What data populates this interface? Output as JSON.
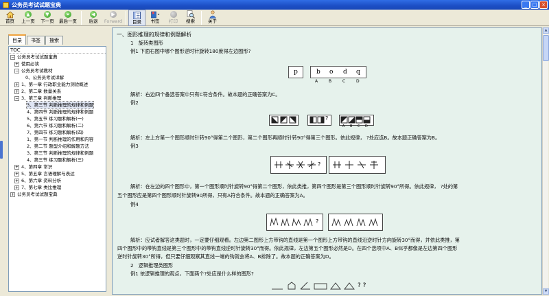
{
  "window": {
    "title": "公务员考试试题宝典",
    "buttons": {
      "minimize": "_",
      "maximize": "□",
      "close": "×"
    }
  },
  "toolbar": {
    "home": "首页",
    "prev_page": "上一页",
    "next_page": "下一页",
    "last_page": "最后一页",
    "back": "后退",
    "forward": "Forward",
    "contents": "目录",
    "bookmark": "书签",
    "print": "打印",
    "search": "搜索",
    "about": "关于"
  },
  "left_pane": {
    "tabs": [
      "目录",
      "书签",
      "搜索"
    ],
    "tree_header": "TOC",
    "tree": [
      {
        "label": "公务员考试试题宝典",
        "expander": "⊟"
      },
      {
        "label": "使用必读",
        "expander": "⊞"
      },
      {
        "label": "公务员考试教材",
        "expander": "⊟"
      },
      {
        "label": "0、公务员考试详解",
        "expander": ""
      },
      {
        "label": "1、第一章 行政职业能力测验概述",
        "expander": "⊞"
      },
      {
        "label": "2、第二章 数量关系",
        "expander": "⊞"
      },
      {
        "label": "3、第三章 判断推理",
        "expander": "⊟"
      },
      {
        "label": "3、第三节 判断推理的规律和例题",
        "expander": "",
        "selected": true
      },
      {
        "label": "4、第四节 判断推理的规律和例题",
        "expander": ""
      },
      {
        "label": "5、第五节 练习题和解析(一)",
        "expander": ""
      },
      {
        "label": "6、第六节 练习题和解析(二)",
        "expander": ""
      },
      {
        "label": "7、第四节 练习题和解析(四)",
        "expander": ""
      },
      {
        "label": "1、第一节 判断推理的作用和内容",
        "expander": ""
      },
      {
        "label": "2、第二节 题型介绍和解题方法",
        "expander": ""
      },
      {
        "label": "3、第三节 判断推理的规律和例题",
        "expander": ""
      },
      {
        "label": "4、第三节 练习题和解析(三)",
        "expander": ""
      },
      {
        "label": "4、第四章 常识",
        "expander": "⊞"
      },
      {
        "label": "5、第五章 言语理解与表达",
        "expander": "⊞"
      },
      {
        "label": "6、第六章 资料分析",
        "expander": "⊞"
      },
      {
        "label": "7、第七章 类比推理",
        "expander": "⊞"
      },
      {
        "label": "公务员考试试题宝典",
        "expander": "⊞"
      }
    ]
  },
  "content": {
    "heading": "一、图形推理的规律和例题解析",
    "section1": "1　旋转类图形",
    "ex1_question": "例1 下面右图中哪个图形逆时针旋转180度得左边图形?",
    "ex1_fig": {
      "left": "p",
      "choices": [
        "b",
        "o",
        "d",
        "q"
      ],
      "labels": [
        "A",
        "B",
        "C",
        "D"
      ]
    },
    "ex1_answer": "解析：右边四个备选答案中只有C符合条件。故本题的正确答案为C。",
    "ex2_title": "例2",
    "ex2_labels": [
      "A",
      "B",
      "C",
      "D"
    ],
    "ex2_q": "?",
    "ex2_answer": "解析：左上方第一个图形顺时针转90°得第二个图形，第二个图形再顺时针转90°得第三个图形。依此规律， ?处应选B。故本题正确答案为B。",
    "ex3_title": "例3",
    "ex3_q": "?",
    "ex3_answer_1": "解析：在左边的四个图形中，第一个图形顺时针旋转90°得第二个图形，依此类推，第四个图形是第三个图形顺时针旋转90°所得。依此规律， ?处的第",
    "ex3_answer_2": "五个图形应是第四个图形顺时针旋转90所得，只有A符合条件。故本题的正确答案为A。",
    "ex4_title": "例4",
    "ex4_q": "?",
    "ex4_answer_1": "解析：应试者解答这类题时，一定要仔细观看。左边第二图形上方带钩的直线是第一个图形上方带钩的直线沿逆时针方向旋转30°而得，并依此类推，第",
    "ex4_answer_2": "四个图形中的带钩直线是第三个图形中的带钩直线逆时针旋转30°而得。依此规律，左边第五个图形必然是D。在四个选项中A、B似乎都像是左边第四个图形",
    "ex4_answer_3": "逆时针旋转30°所得，但只要仔细观察其直线一端的钩就会将A、B排除了。故本题的正确答案为D。",
    "section2": "2　逻辑推理类图形",
    "ex5_question": "例1 依逻辑推理的观点，下面两个?处应是什么样的图形?",
    "ex5_q": "? ?"
  }
}
